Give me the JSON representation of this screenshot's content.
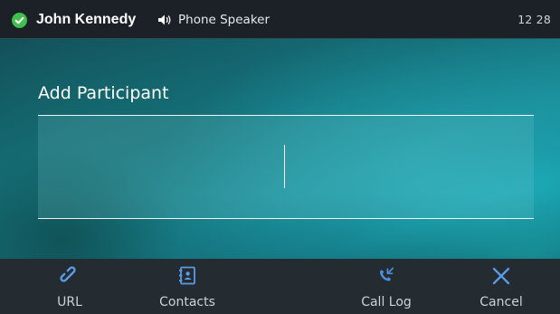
{
  "status_bar": {
    "line_name": "John Kennedy",
    "audio_mode": "Phone Speaker",
    "time": "12 28",
    "icons": {
      "registration": "check-circle-icon",
      "audio": "speaker-icon"
    }
  },
  "screen": {
    "title": "Add Participant",
    "input_value": ""
  },
  "softkeys": [
    {
      "label": "URL",
      "icon": "link-icon"
    },
    {
      "label": "Contacts",
      "icon": "contacts-book-icon"
    },
    {
      "label": "Call Log",
      "icon": "phone-incoming-icon"
    },
    {
      "label": "Cancel",
      "icon": "close-icon"
    }
  ],
  "colors": {
    "accent_blue": "#4a90d9",
    "status_green": "#3fbf4c",
    "teal_background": "#1a8c98",
    "bar_background": "#242b31"
  }
}
